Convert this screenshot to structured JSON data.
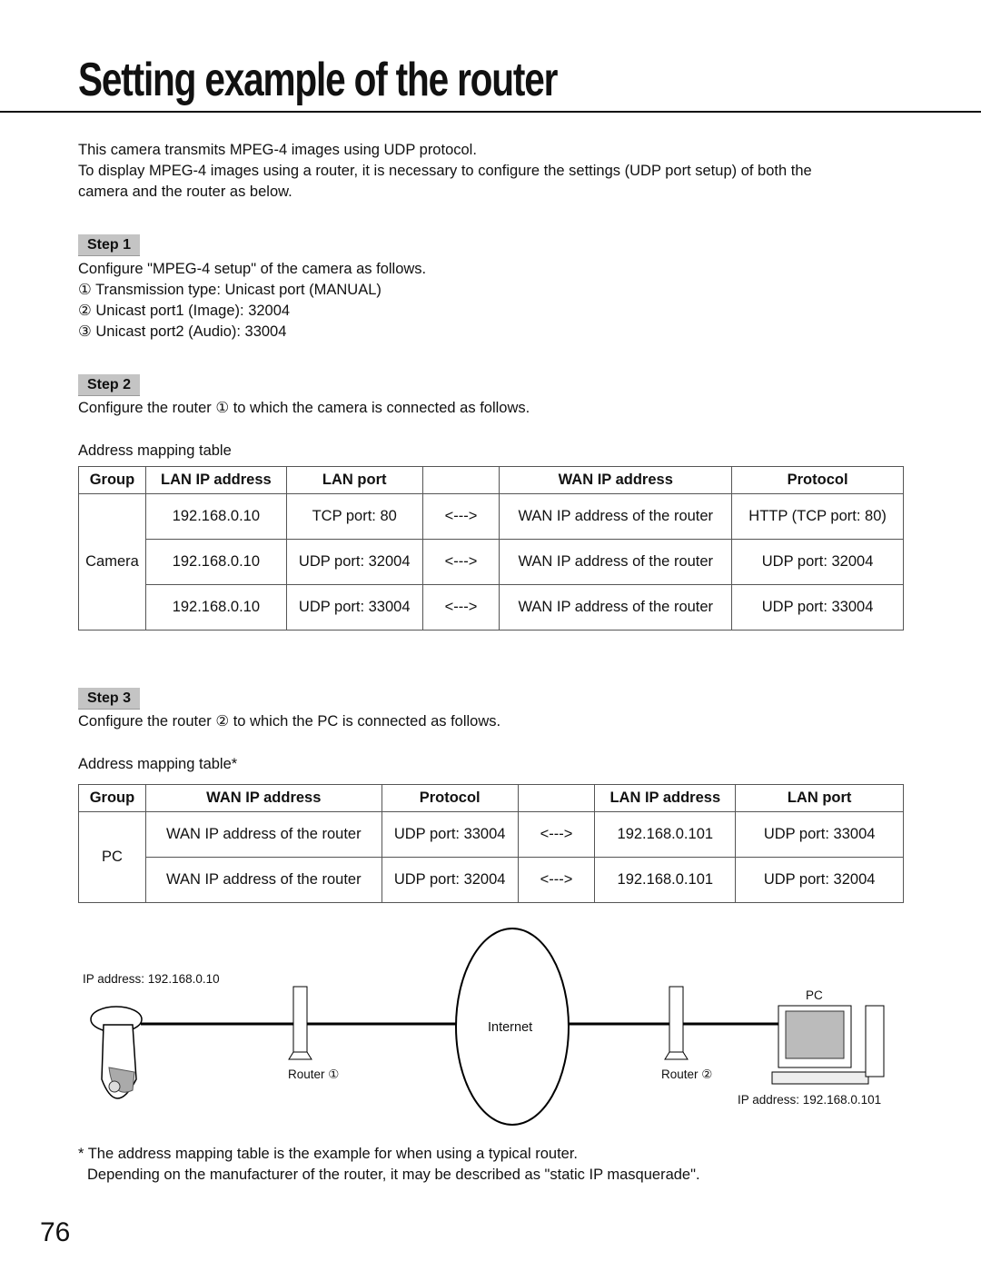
{
  "title": "Setting example of the router",
  "intro": [
    "This camera transmits MPEG-4 images using UDP protocol.",
    "To display MPEG-4 images using a router, it is necessary to configure the settings (UDP port setup) of both the",
    "camera and the router as below."
  ],
  "step1": {
    "label": "Step 1",
    "text": "Configure \"MPEG-4 setup\" of the camera as follows.",
    "items": [
      "① Transmission type: Unicast port (MANUAL)",
      "② Unicast port1 (Image): 32004",
      "③ Unicast port2 (Audio): 33004"
    ]
  },
  "step2": {
    "label": "Step 2",
    "text": "Configure the router ① to which the camera is connected as follows.",
    "table_caption": "Address mapping table",
    "headers": [
      "Group",
      "LAN IP address",
      "LAN port",
      "",
      "WAN IP address",
      "Protocol"
    ],
    "group": "Camera",
    "rows": [
      [
        "192.168.0.10",
        "TCP port: 80",
        "<--->",
        "WAN IP address of the router",
        "HTTP (TCP port: 80)"
      ],
      [
        "192.168.0.10",
        "UDP port: 32004",
        "<--->",
        "WAN IP address of the router",
        "UDP port: 32004"
      ],
      [
        "192.168.0.10",
        "UDP port: 33004",
        "<--->",
        "WAN IP address of the router",
        "UDP port: 33004"
      ]
    ]
  },
  "step3": {
    "label": "Step 3",
    "text": "Configure the router ② to which the PC is connected as follows.",
    "table_caption": "Address mapping table*",
    "headers": [
      "Group",
      "WAN IP address",
      "Protocol",
      "",
      "LAN IP address",
      "LAN port"
    ],
    "group": "PC",
    "rows": [
      [
        "WAN IP address of the router",
        "UDP port: 33004",
        "<--->",
        "192.168.0.101",
        "UDP port: 33004"
      ],
      [
        "WAN IP address of the router",
        "UDP port: 32004",
        "<--->",
        "192.168.0.101",
        "UDP port: 32004"
      ]
    ]
  },
  "diagram": {
    "camera_ip": "IP address: 192.168.0.10",
    "router1": "Router ①",
    "internet": "Internet",
    "router2": "Router ②",
    "pc": "PC",
    "pc_ip": "IP address: 192.168.0.101"
  },
  "footnote": [
    "* The address mapping table is the example for when using a typical router.",
    "Depending on the manufacturer of the router, it may be described as \"static IP masquerade\"."
  ],
  "page_number": "76"
}
